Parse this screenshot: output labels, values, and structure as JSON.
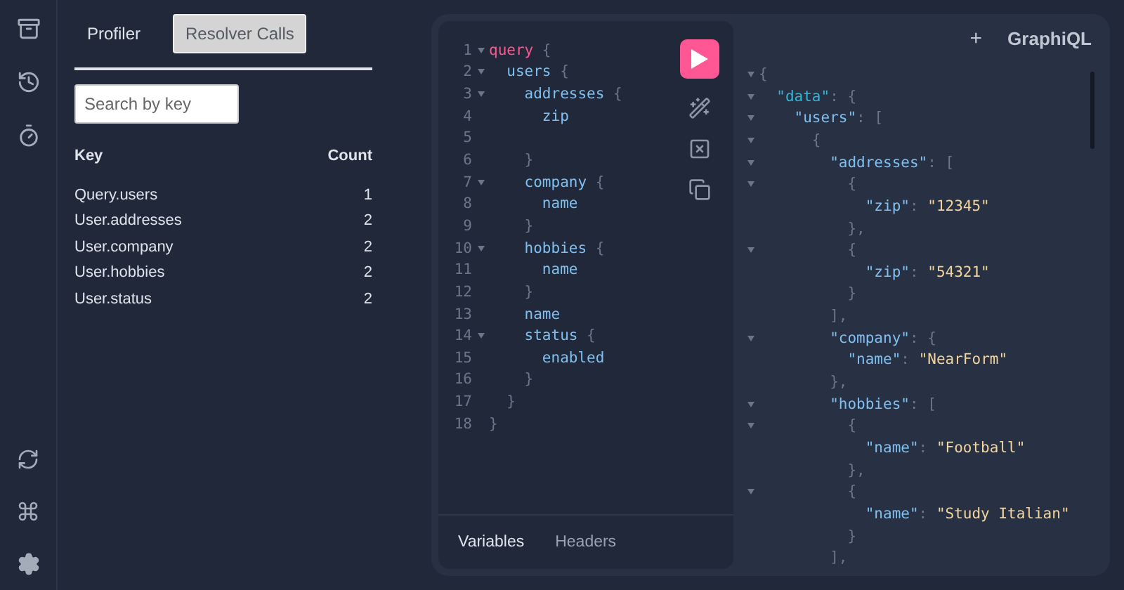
{
  "plugin_tabs": [
    {
      "label": "Profiler",
      "selected": false
    },
    {
      "label": "Resolver Calls",
      "selected": true
    }
  ],
  "search": {
    "placeholder": "Search by key"
  },
  "table": {
    "columns": [
      "Key",
      "Count"
    ],
    "rows": [
      {
        "key": "Query.users",
        "count": "1"
      },
      {
        "key": "User.addresses",
        "count": "2"
      },
      {
        "key": "User.company",
        "count": "2"
      },
      {
        "key": "User.hobbies",
        "count": "2"
      },
      {
        "key": "User.status",
        "count": "2"
      }
    ]
  },
  "editor": {
    "lines": [
      {
        "number": "1",
        "fold": true,
        "tokens": [
          {
            "kind": "keyword",
            "text": "query"
          },
          {
            "kind": "punct",
            "text": " {"
          }
        ]
      },
      {
        "number": "2",
        "fold": true,
        "tokens": [
          {
            "kind": "field",
            "text": "  users"
          },
          {
            "kind": "punct",
            "text": " {"
          }
        ]
      },
      {
        "number": "3",
        "fold": true,
        "tokens": [
          {
            "kind": "field",
            "text": "    addresses"
          },
          {
            "kind": "punct",
            "text": " {"
          }
        ]
      },
      {
        "number": "4",
        "fold": false,
        "tokens": [
          {
            "kind": "field",
            "text": "      zip"
          }
        ]
      },
      {
        "number": "5",
        "fold": false
      },
      {
        "number": "6",
        "fold": false,
        "tokens": [
          {
            "kind": "punct",
            "text": "    }"
          }
        ]
      },
      {
        "number": "7",
        "fold": true,
        "tokens": [
          {
            "kind": "field",
            "text": "    company"
          },
          {
            "kind": "punct",
            "text": " {"
          }
        ]
      },
      {
        "number": "8",
        "fold": false,
        "tokens": [
          {
            "kind": "field",
            "text": "      name"
          }
        ]
      },
      {
        "number": "9",
        "fold": false,
        "tokens": [
          {
            "kind": "punct",
            "text": "    }"
          }
        ]
      },
      {
        "number": "10",
        "fold": true,
        "tokens": [
          {
            "kind": "field",
            "text": "    hobbies"
          },
          {
            "kind": "punct",
            "text": " {"
          }
        ]
      },
      {
        "number": "11",
        "fold": false,
        "tokens": [
          {
            "kind": "field",
            "text": "      name"
          }
        ]
      },
      {
        "number": "12",
        "fold": false,
        "tokens": [
          {
            "kind": "punct",
            "text": "    }"
          }
        ]
      },
      {
        "number": "13",
        "fold": false,
        "tokens": [
          {
            "kind": "field",
            "text": "    name"
          }
        ]
      },
      {
        "number": "14",
        "fold": true,
        "tokens": [
          {
            "kind": "field",
            "text": "    status"
          },
          {
            "kind": "punct",
            "text": " {"
          }
        ]
      },
      {
        "number": "15",
        "fold": false,
        "tokens": [
          {
            "kind": "field",
            "text": "      enabled"
          }
        ]
      },
      {
        "number": "16",
        "fold": false,
        "tokens": [
          {
            "kind": "punct",
            "text": "    }"
          }
        ]
      },
      {
        "number": "17",
        "fold": false,
        "tokens": [
          {
            "kind": "punct",
            "text": "  }"
          }
        ]
      },
      {
        "number": "18",
        "fold": false,
        "tokens": [
          {
            "kind": "punct",
            "text": "}"
          }
        ]
      }
    ]
  },
  "editor_tabs": [
    {
      "label": "Variables",
      "selected": true
    },
    {
      "label": "Headers",
      "selected": false
    }
  ],
  "results": {
    "add": "+",
    "logo": "GraphiQL",
    "lines": [
      {
        "fold": true,
        "tokens": [
          {
            "kind": "punct",
            "text": "{"
          }
        ]
      },
      {
        "fold": true,
        "tokens": [
          {
            "kind": "rootkey",
            "text": "  \"data\""
          },
          {
            "kind": "punct",
            "text": ": {"
          }
        ]
      },
      {
        "fold": true,
        "tokens": [
          {
            "kind": "key",
            "text": "    \"users\""
          },
          {
            "kind": "punct",
            "text": ": ["
          }
        ]
      },
      {
        "fold": true,
        "tokens": [
          {
            "kind": "punct",
            "text": "      {"
          }
        ]
      },
      {
        "fold": true,
        "tokens": [
          {
            "kind": "key",
            "text": "        \"addresses\""
          },
          {
            "kind": "punct",
            "text": ": ["
          }
        ]
      },
      {
        "fold": true,
        "tokens": [
          {
            "kind": "punct",
            "text": "          {"
          }
        ]
      },
      {
        "fold": false,
        "tokens": [
          {
            "kind": "key",
            "text": "            \"zip\""
          },
          {
            "kind": "punct",
            "text": ": "
          },
          {
            "kind": "string",
            "text": "\"12345\""
          }
        ]
      },
      {
        "fold": false,
        "tokens": [
          {
            "kind": "punct",
            "text": "          },"
          }
        ]
      },
      {
        "fold": true,
        "tokens": [
          {
            "kind": "punct",
            "text": "          {"
          }
        ]
      },
      {
        "fold": false,
        "tokens": [
          {
            "kind": "key",
            "text": "            \"zip\""
          },
          {
            "kind": "punct",
            "text": ": "
          },
          {
            "kind": "string",
            "text": "\"54321\""
          }
        ]
      },
      {
        "fold": false,
        "tokens": [
          {
            "kind": "punct",
            "text": "          }"
          }
        ]
      },
      {
        "fold": false,
        "tokens": [
          {
            "kind": "punct",
            "text": "        ],"
          }
        ]
      },
      {
        "fold": true,
        "tokens": [
          {
            "kind": "key",
            "text": "        \"company\""
          },
          {
            "kind": "punct",
            "text": ": {"
          }
        ]
      },
      {
        "fold": false,
        "tokens": [
          {
            "kind": "key",
            "text": "          \"name\""
          },
          {
            "kind": "punct",
            "text": ": "
          },
          {
            "kind": "string",
            "text": "\"NearForm\""
          }
        ]
      },
      {
        "fold": false,
        "tokens": [
          {
            "kind": "punct",
            "text": "        },"
          }
        ]
      },
      {
        "fold": true,
        "tokens": [
          {
            "kind": "key",
            "text": "        \"hobbies\""
          },
          {
            "kind": "punct",
            "text": ": ["
          }
        ]
      },
      {
        "fold": true,
        "tokens": [
          {
            "kind": "punct",
            "text": "          {"
          }
        ]
      },
      {
        "fold": false,
        "tokens": [
          {
            "kind": "key",
            "text": "            \"name\""
          },
          {
            "kind": "punct",
            "text": ": "
          },
          {
            "kind": "string",
            "text": "\"Football\""
          }
        ]
      },
      {
        "fold": false,
        "tokens": [
          {
            "kind": "punct",
            "text": "          },"
          }
        ]
      },
      {
        "fold": true,
        "tokens": [
          {
            "kind": "punct",
            "text": "          {"
          }
        ]
      },
      {
        "fold": false,
        "tokens": [
          {
            "kind": "key",
            "text": "            \"name\""
          },
          {
            "kind": "punct",
            "text": ": "
          },
          {
            "kind": "string",
            "text": "\"Study Italian\""
          }
        ]
      },
      {
        "fold": false,
        "tokens": [
          {
            "kind": "punct",
            "text": "          }"
          }
        ]
      },
      {
        "fold": false,
        "tokens": [
          {
            "kind": "punct",
            "text": "        ],"
          }
        ]
      }
    ]
  }
}
